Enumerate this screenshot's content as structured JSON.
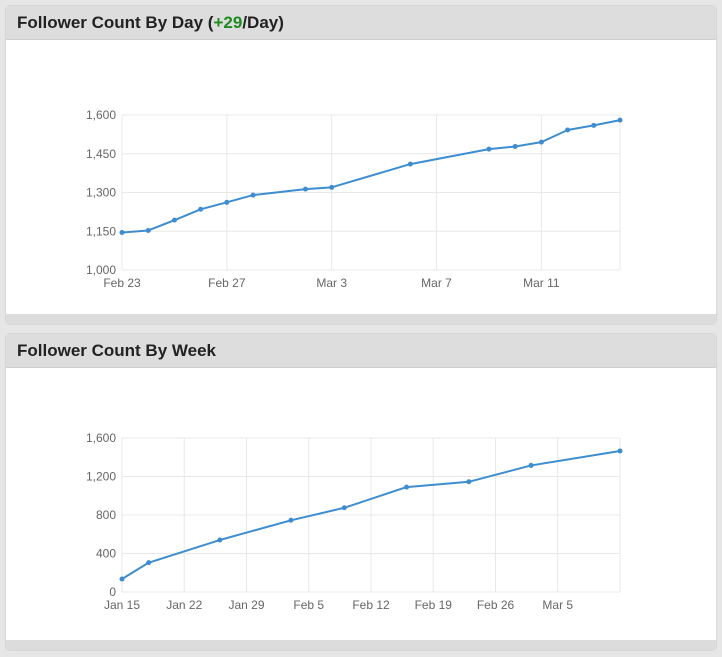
{
  "panels": [
    {
      "title_prefix": "Follower Count By Day (",
      "title_accent": "+29",
      "title_suffix": "/Day)"
    },
    {
      "title_prefix": "Follower Count By Week",
      "title_accent": "",
      "title_suffix": ""
    }
  ],
  "colors": {
    "line": "#3d8dd0",
    "accent": "#1f8a1f",
    "grid": "#e8e8e8"
  },
  "chart_data": [
    {
      "type": "line",
      "title": "Follower Count By Day (+29/Day)",
      "xlabel": "",
      "ylabel": "",
      "x_tick_labels": [
        "Feb 23",
        "Feb 27",
        "Mar 3",
        "Mar 7",
        "Mar 11"
      ],
      "y_ticks": [
        1000,
        1150,
        1300,
        1450,
        1600
      ],
      "y_tick_labels": [
        "1,000",
        "1,150",
        "1,300",
        "1,450",
        "1,600"
      ],
      "ylim": [
        1000,
        1600
      ],
      "xlim": [
        "Feb 23",
        "Mar 14"
      ],
      "grid": true,
      "series": [
        {
          "x": [
            "Feb 23",
            "Feb 24",
            "Feb 25",
            "Feb 26",
            "Feb 27",
            "Feb 28",
            "Mar 2",
            "Mar 3",
            "Mar 6",
            "Mar 9",
            "Mar 10",
            "Mar 11",
            "Mar 12",
            "Mar 13",
            "Mar 14"
          ],
          "values": [
            1145,
            1153,
            1193,
            1235,
            1262,
            1290,
            1313,
            1320,
            1410,
            1468,
            1478,
            1495,
            1542,
            1560,
            1580
          ]
        }
      ]
    },
    {
      "type": "line",
      "title": "Follower Count By Week",
      "xlabel": "",
      "ylabel": "",
      "x_tick_labels": [
        "Jan 15",
        "Jan 22",
        "Jan 29",
        "Feb 5",
        "Feb 12",
        "Feb 19",
        "Feb 26",
        "Mar 5"
      ],
      "y_ticks": [
        0,
        400,
        800,
        1200,
        1600
      ],
      "y_tick_labels": [
        "0",
        "400",
        "800",
        "1,200",
        "1,600"
      ],
      "ylim": [
        0,
        1600
      ],
      "xlim": [
        "Jan 15",
        "Mar 12"
      ],
      "grid": true,
      "series": [
        {
          "x": [
            "Jan 15",
            "Jan 18",
            "Jan 26",
            "Feb 3",
            "Feb 9",
            "Feb 16",
            "Feb 23",
            "Mar 2",
            "Mar 12"
          ],
          "values": [
            135,
            305,
            540,
            745,
            875,
            1090,
            1145,
            1315,
            1465
          ]
        }
      ]
    }
  ]
}
